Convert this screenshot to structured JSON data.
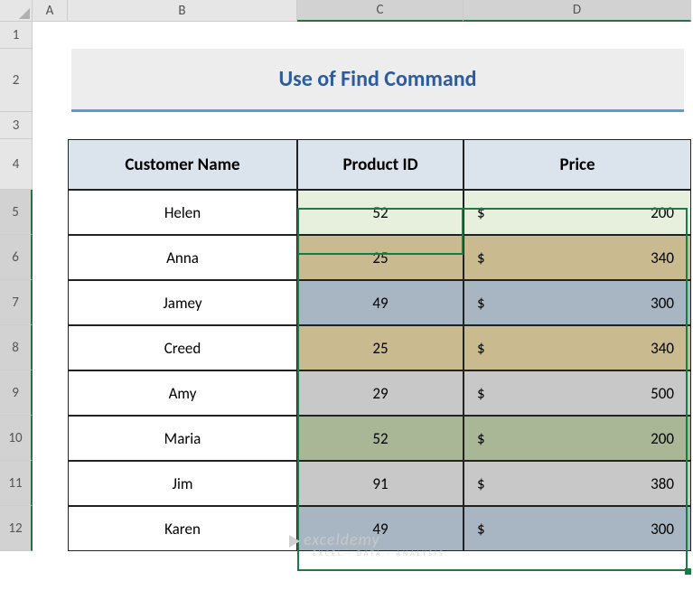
{
  "columns": {
    "A": "A",
    "B": "B",
    "C": "C",
    "D": "D"
  },
  "rows": [
    "1",
    "2",
    "3",
    "4",
    "5",
    "6",
    "7",
    "8",
    "9",
    "10",
    "11",
    "12"
  ],
  "title": "Use of Find Command",
  "headers": {
    "name": "Customer Name",
    "pid": "Product ID",
    "price": "Price"
  },
  "currency": "$",
  "data": [
    {
      "name": "Helen",
      "pid": "52",
      "price": "200",
      "color": "lightgreen"
    },
    {
      "name": "Anna",
      "pid": "25",
      "price": "340",
      "color": "tan"
    },
    {
      "name": "Jamey",
      "pid": "49",
      "price": "300",
      "color": "blue"
    },
    {
      "name": "Creed",
      "pid": "25",
      "price": "340",
      "color": "tan"
    },
    {
      "name": "Amy",
      "pid": "29",
      "price": "500",
      "color": "gray"
    },
    {
      "name": "Maria",
      "pid": "52",
      "price": "200",
      "color": "olive"
    },
    {
      "name": "Jim",
      "pid": "91",
      "price": "380",
      "color": "gray"
    },
    {
      "name": "Karen",
      "pid": "49",
      "price": "300",
      "color": "blue"
    }
  ],
  "watermark": {
    "main": "exceldemy",
    "sub": "EXCEL · DATA · ANALYSIS"
  },
  "chart_data": {
    "type": "table",
    "title": "Use of Find Command",
    "columns": [
      "Customer Name",
      "Product ID",
      "Price"
    ],
    "rows": [
      [
        "Helen",
        52,
        200
      ],
      [
        "Anna",
        25,
        340
      ],
      [
        "Jamey",
        49,
        300
      ],
      [
        "Creed",
        25,
        340
      ],
      [
        "Amy",
        29,
        500
      ],
      [
        "Maria",
        52,
        200
      ],
      [
        "Jim",
        91,
        380
      ],
      [
        "Karen",
        49,
        300
      ]
    ]
  }
}
